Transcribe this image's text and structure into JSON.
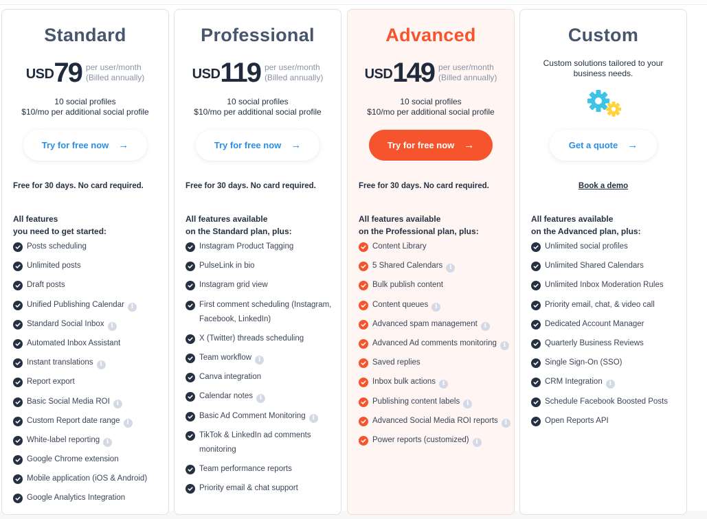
{
  "plans": [
    {
      "name": "Standard",
      "currency": "USD",
      "price": "79",
      "per_line1": "per user/month",
      "per_line2": "(Billed annually)",
      "profiles_line1": "10 social profiles",
      "profiles_line2": "$10/mo per additional social profile",
      "cta_label": "Try for free now",
      "cta_arrow": "→",
      "trial_note": "Free for 30 days. No card required.",
      "features_heading_line1": "All features",
      "features_heading_line2": "you need to get started:",
      "features": [
        {
          "label": "Posts scheduling",
          "info": false
        },
        {
          "label": "Unlimited posts",
          "info": false
        },
        {
          "label": "Draft posts",
          "info": false
        },
        {
          "label": "Unified Publishing Calendar",
          "info": true
        },
        {
          "label": "Standard Social Inbox",
          "info": true
        },
        {
          "label": "Automated Inbox Assistant",
          "info": false
        },
        {
          "label": "Instant translations",
          "info": true
        },
        {
          "label": "Report export",
          "info": false
        },
        {
          "label": "Basic Social Media ROI",
          "info": true
        },
        {
          "label": "Custom Report date range",
          "info": true
        },
        {
          "label": "White-label reporting",
          "info": true
        },
        {
          "label": "Google Chrome extension",
          "info": false
        },
        {
          "label": "Mobile application (iOS & Android)",
          "info": false
        },
        {
          "label": "Google Analytics Integration",
          "info": false
        }
      ]
    },
    {
      "name": "Professional",
      "currency": "USD",
      "price": "119",
      "per_line1": "per user/month",
      "per_line2": "(Billed annually)",
      "profiles_line1": "10 social profiles",
      "profiles_line2": "$10/mo per additional social profile",
      "cta_label": "Try for free now",
      "cta_arrow": "→",
      "trial_note": "Free for 30 days. No card required.",
      "features_heading_line1": "All features available",
      "features_heading_line2": "on the Standard plan, plus:",
      "features": [
        {
          "label": "Instagram Product Tagging",
          "info": false
        },
        {
          "label": "PulseLink in bio",
          "info": false
        },
        {
          "label": "Instagram grid view",
          "info": false
        },
        {
          "label": "First comment scheduling (Instagram, Facebook, LinkedIn)",
          "info": false
        },
        {
          "label": "X (Twitter) threads scheduling",
          "info": false
        },
        {
          "label": "Team workflow",
          "info": true
        },
        {
          "label": "Canva integration",
          "info": false
        },
        {
          "label": "Calendar notes",
          "info": true
        },
        {
          "label": "Basic Ad Comment Monitoring",
          "info": true
        },
        {
          "label": "TikTok & LinkedIn ad comments monitoring",
          "info": false
        },
        {
          "label": "Team performance reports",
          "info": false
        },
        {
          "label": "Priority email & chat support",
          "info": false
        }
      ]
    },
    {
      "name": "Advanced",
      "currency": "USD",
      "price": "149",
      "per_line1": "per user/month",
      "per_line2": "(Billed annually)",
      "profiles_line1": "10 social profiles",
      "profiles_line2": "$10/mo per additional social profile",
      "cta_label": "Try for free now",
      "cta_arrow": "→",
      "trial_note": "Free for 30 days. No card required.",
      "features_heading_line1": "All features available",
      "features_heading_line2": "on the Professional plan, plus:",
      "features": [
        {
          "label": "Content Library",
          "info": false
        },
        {
          "label": "5 Shared Calendars",
          "info": true
        },
        {
          "label": "Bulk publish content",
          "info": false
        },
        {
          "label": "Content queues",
          "info": true
        },
        {
          "label": "Advanced spam management",
          "info": true
        },
        {
          "label": "Advanced Ad comments monitoring",
          "info": true
        },
        {
          "label": "Saved replies",
          "info": false
        },
        {
          "label": "Inbox bulk actions",
          "info": true
        },
        {
          "label": "Publishing content labels",
          "info": true
        },
        {
          "label": "Advanced Social Media ROI reports",
          "info": true
        },
        {
          "label": "Power reports (customized)",
          "info": true
        }
      ]
    },
    {
      "name": "Custom",
      "description": "Custom solutions tailored to your business needs.",
      "icon": "gears-icon",
      "cta_label": "Get a quote",
      "cta_arrow": "→",
      "demo_link": "Book a demo",
      "features_heading_line1": "All features available",
      "features_heading_line2": "on the Advanced plan, plus:",
      "features": [
        {
          "label": "Unlimited social profiles",
          "info": false
        },
        {
          "label": "Unlimited Shared Calendars",
          "info": false
        },
        {
          "label": "Unlimited Inbox Moderation Rules",
          "info": false
        },
        {
          "label": "Priority email, chat, & video call",
          "info": false
        },
        {
          "label": "Dedicated Account Manager",
          "info": false
        },
        {
          "label": "Quarterly Business Reviews",
          "info": false
        },
        {
          "label": "Single Sign-On (SSO)",
          "info": false
        },
        {
          "label": "CRM Integration",
          "info": true
        },
        {
          "label": "Schedule Facebook Boosted Posts",
          "info": false
        },
        {
          "label": "Open Reports API",
          "info": false
        }
      ]
    }
  ],
  "colors": {
    "accent": "#f5542c",
    "link_blue": "#2a8ee8",
    "navy": "#253142",
    "featured_bg": "#fff5f2",
    "gear_blue": "#3cc3e6",
    "gear_yellow": "#ffd23f"
  },
  "info_glyph": "i"
}
